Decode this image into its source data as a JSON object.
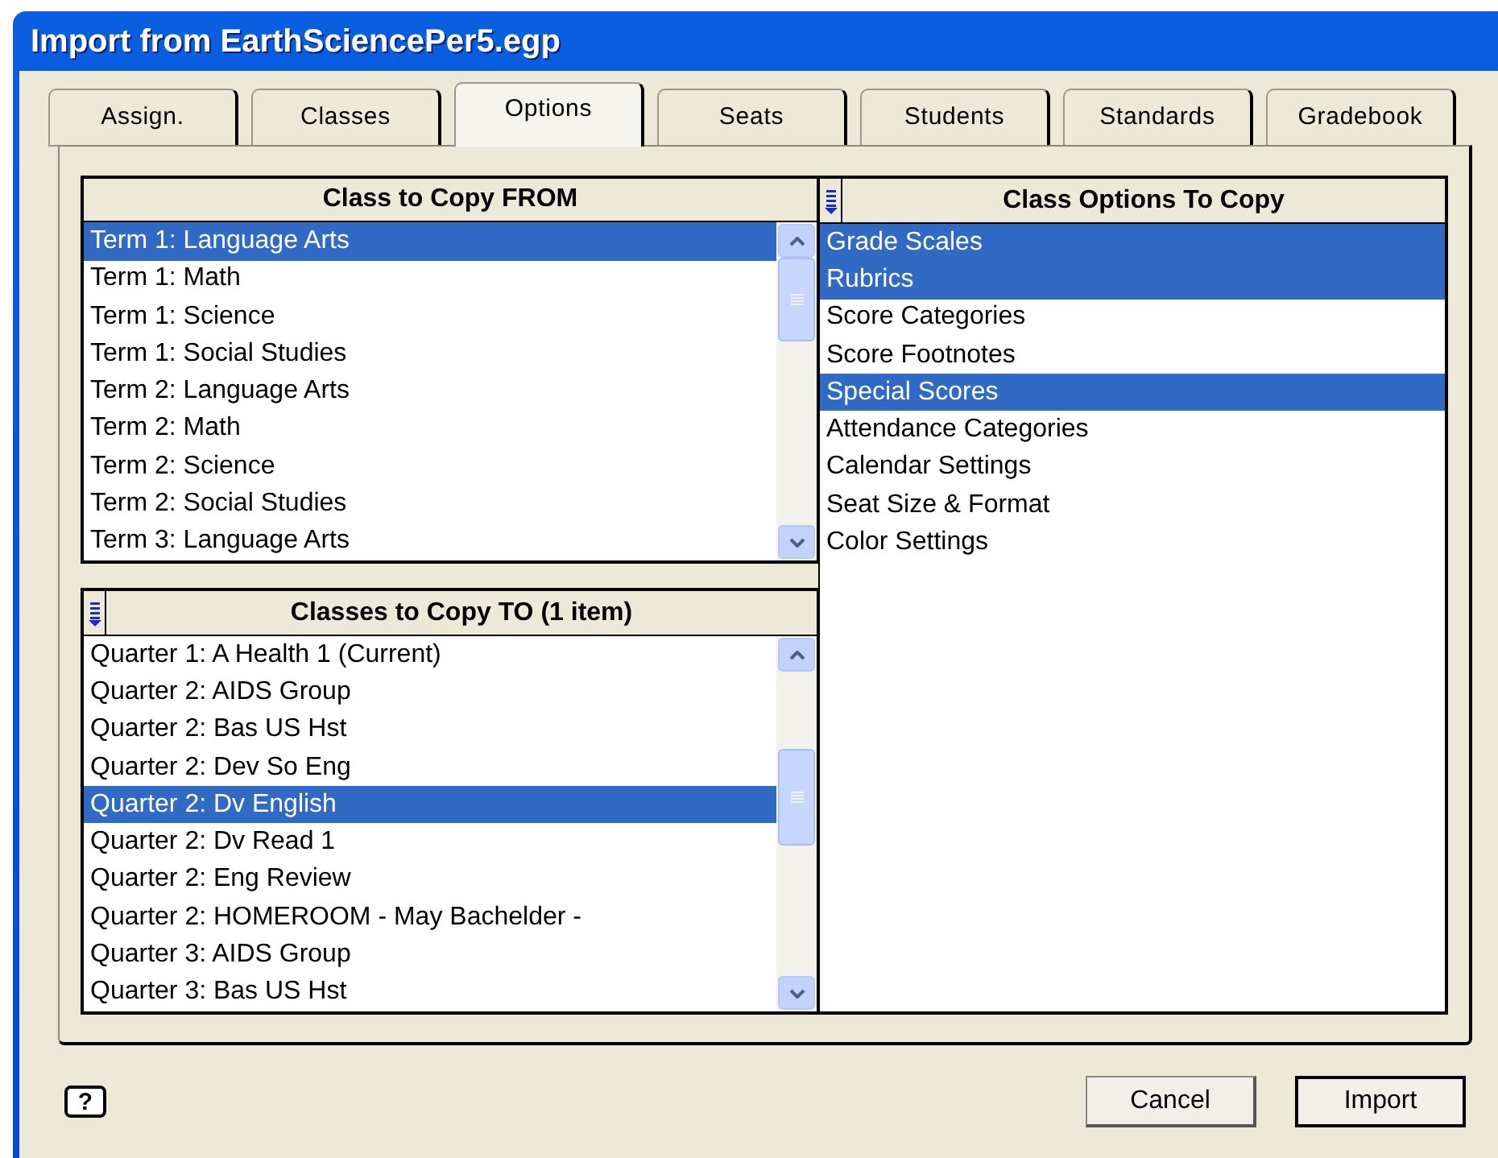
{
  "window": {
    "title": "Import from EarthSciencePer5.egp"
  },
  "tabs": [
    {
      "label": "Assign.",
      "selected": false
    },
    {
      "label": "Classes",
      "selected": false
    },
    {
      "label": "Options",
      "selected": true
    },
    {
      "label": "Seats",
      "selected": false
    },
    {
      "label": "Students",
      "selected": false
    },
    {
      "label": "Standards",
      "selected": false
    },
    {
      "label": "Gradebook",
      "selected": false
    }
  ],
  "from_list": {
    "header": "Class to Copy FROM",
    "items": [
      {
        "label": "Term 1: Language Arts",
        "selected": true
      },
      {
        "label": "Term 1: Math",
        "selected": false
      },
      {
        "label": "Term 1: Science",
        "selected": false
      },
      {
        "label": "Term 1: Social Studies",
        "selected": false
      },
      {
        "label": "Term 2: Language Arts",
        "selected": false
      },
      {
        "label": "Term 2: Math",
        "selected": false
      },
      {
        "label": "Term 2: Science",
        "selected": false
      },
      {
        "label": "Term 2: Social Studies",
        "selected": false
      },
      {
        "label": "Term 3: Language Arts",
        "selected": false
      }
    ]
  },
  "to_list": {
    "header": "Classes to Copy TO  (1 item)",
    "items": [
      {
        "label": "Quarter 1: A Health 1 (Current)",
        "selected": false
      },
      {
        "label": "Quarter 2: AIDS Group",
        "selected": false
      },
      {
        "label": "Quarter 2: Bas US Hst",
        "selected": false
      },
      {
        "label": "Quarter 2: Dev So Eng",
        "selected": false
      },
      {
        "label": "Quarter 2: Dv English",
        "selected": true
      },
      {
        "label": "Quarter 2: Dv Read 1",
        "selected": false
      },
      {
        "label": "Quarter 2: Eng Review",
        "selected": false
      },
      {
        "label": "Quarter 2: HOMEROOM - May Bachelder -",
        "selected": false
      },
      {
        "label": "Quarter 3: AIDS Group",
        "selected": false
      },
      {
        "label": "Quarter 3: Bas US Hst",
        "selected": false
      }
    ]
  },
  "options_list": {
    "header": "Class Options To Copy",
    "items": [
      {
        "label": "Grade Scales",
        "selected": true
      },
      {
        "label": "Rubrics",
        "selected": true
      },
      {
        "label": "Score Categories",
        "selected": false
      },
      {
        "label": "Score Footnotes",
        "selected": false
      },
      {
        "label": "Special Scores",
        "selected": true
      },
      {
        "label": "Attendance Categories",
        "selected": false
      },
      {
        "label": "Calendar Settings",
        "selected": false
      },
      {
        "label": "Seat Size & Format",
        "selected": false
      },
      {
        "label": "Color Settings",
        "selected": false
      }
    ]
  },
  "help_button": {
    "label": "?"
  },
  "buttons": [
    {
      "label": "Cancel",
      "kind": "normal"
    },
    {
      "label": "Import",
      "kind": "default"
    }
  ]
}
